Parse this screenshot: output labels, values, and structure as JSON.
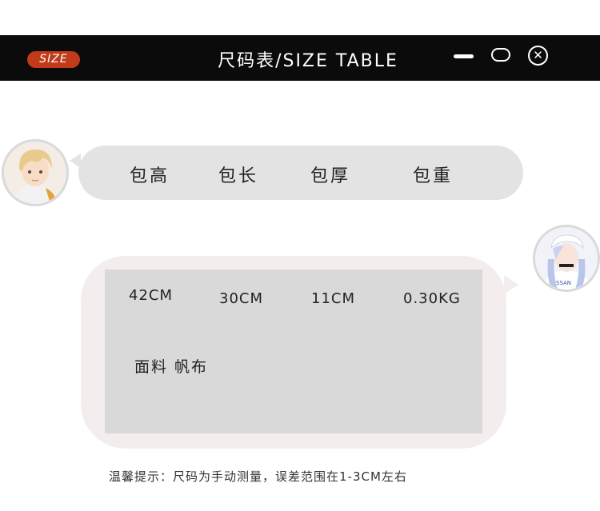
{
  "titlebar": {
    "badge": "SIZE",
    "title": "尺码表/SIZE TABLE",
    "controls": {
      "minimize_icon": "minimize-icon",
      "maximize_icon": "maximize-icon",
      "close_icon": "close-icon",
      "close_glyph": "✕"
    },
    "badge_color": "#c13a19",
    "bar_color": "#0b0b0b"
  },
  "header_bubble": {
    "labels": [
      "包高",
      "包长",
      "包厚",
      "包重"
    ]
  },
  "values_bubble": {
    "values": [
      "42CM",
      "30CM",
      "11CM",
      "0.30KG"
    ],
    "material": "面料 帆布"
  },
  "footnote": "温馨提示：尺码为手动测量，误差范围在1-3CM左右",
  "colors": {
    "bubble_gray": "#e3e3e3",
    "panel_gray": "#d9d9d9",
    "outer_pink": "#f3eeed"
  }
}
